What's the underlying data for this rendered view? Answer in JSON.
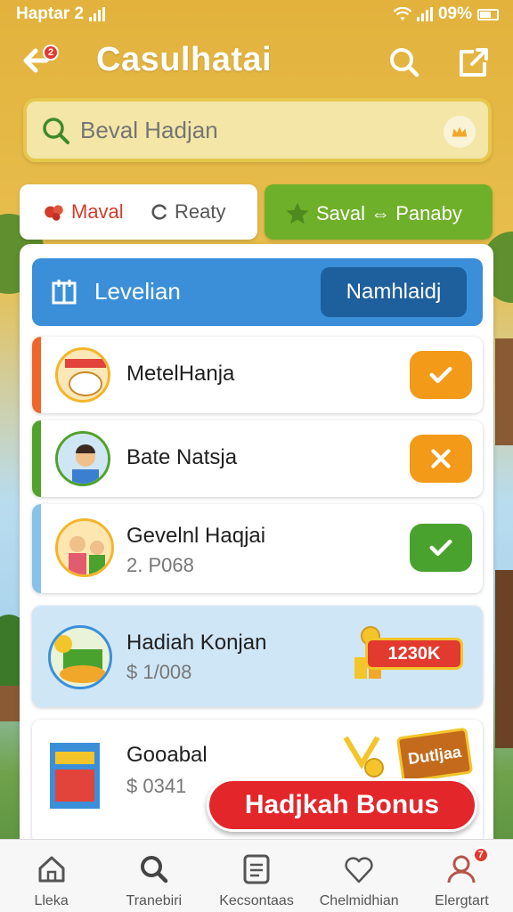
{
  "status_bar": {
    "left_text": "Haptar 2",
    "battery": "09%"
  },
  "header": {
    "title": "Casulhatai",
    "back_badge": "2"
  },
  "search": {
    "placeholder": "Beval Hadjan"
  },
  "tabs": {
    "left": [
      {
        "label": "Maval",
        "color": "#d33c2c"
      },
      {
        "label": "Reaty",
        "color": "#555555"
      }
    ],
    "right": {
      "label": "Saval ⇔ Panaby"
    }
  },
  "level_bar": {
    "label": "Levelian",
    "button": "Namhlaidj"
  },
  "rows": [
    {
      "title": "MetelHanja",
      "subtitle": "",
      "action": "check",
      "stripe_color": "#f0662a",
      "button_color": "#f39a18"
    },
    {
      "title": "Bate Natsja",
      "subtitle": "",
      "action": "close",
      "stripe_color": "#4fa22a",
      "button_color": "#f39a18"
    },
    {
      "title": "Gevelnl Haqjai",
      "subtitle": "2. P068",
      "action": "check",
      "stripe_color": "#88c2ea",
      "button_color": "#4aa22e"
    },
    {
      "title": "Hadiah Konjan",
      "subtitle": "$ 1/008",
      "action": "bonus",
      "bonus_label": "1230K"
    },
    {
      "title": "Gooabal",
      "subtitle": "$ 0341",
      "action": "reward",
      "reward_label": "Dutljaa"
    }
  ],
  "floating_button": {
    "label": "Hadjkah Bonus"
  },
  "bottom_nav": [
    {
      "label": "Lleka",
      "icon": "home-icon"
    },
    {
      "label": "Tranebiri",
      "icon": "search-icon"
    },
    {
      "label": "Kecsontaas",
      "icon": "list-icon"
    },
    {
      "label": "Chelmidhian",
      "icon": "heart-icon"
    },
    {
      "label": "Elergtart",
      "icon": "profile-icon",
      "badge": "7"
    }
  ]
}
